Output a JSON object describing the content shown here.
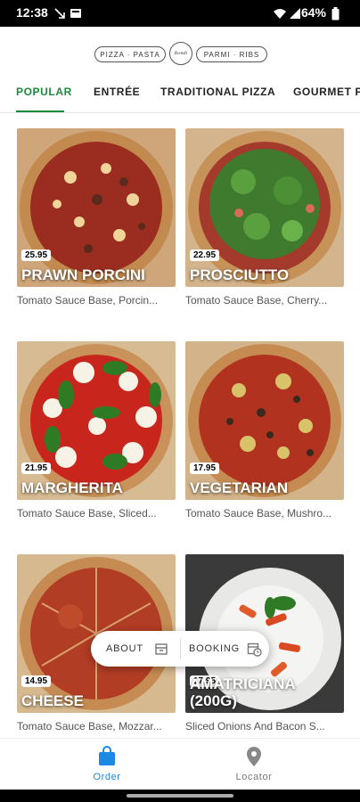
{
  "status_bar": {
    "time": "12:38",
    "battery": "64%"
  },
  "header": {
    "logo_left": "PIZZA · PASTA",
    "logo_right": "PARMI · RIBS",
    "logo_center": "Bondi"
  },
  "tabs": [
    {
      "label": "POPULAR",
      "active": true
    },
    {
      "label": "ENTRÉE",
      "active": false
    },
    {
      "label": "TRADITIONAL PIZZA",
      "active": false
    },
    {
      "label": "GOURMET PI",
      "active": false
    }
  ],
  "menu_items": [
    {
      "price": "25.95",
      "name": "PRAWN PORCINI",
      "desc": "Tomato Sauce Base, Porcin..."
    },
    {
      "price": "22.95",
      "name": "PROSCIUTTO",
      "desc": "Tomato Sauce Base, Cherry..."
    },
    {
      "price": "21.95",
      "name": "MARGHERITA",
      "desc": "Tomato Sauce Base, Sliced..."
    },
    {
      "price": "17.95",
      "name": "VEGETARIAN",
      "desc": "Tomato Sauce Base, Mushro..."
    },
    {
      "price": "14.95",
      "name": "CHEESE",
      "desc": "Tomato Sauce Base, Mozzar..."
    },
    {
      "price": "17.95",
      "name": "AMATRICIANA (200G)",
      "desc": "Sliced Onions And Bacon S..."
    }
  ],
  "floating_bar": {
    "about": "ABOUT",
    "booking": "BOOKING"
  },
  "bottom_nav": {
    "order": "Order",
    "locator": "Locator"
  },
  "colors": {
    "accent": "#1a8a3a",
    "nav_active": "#1e88e5"
  }
}
